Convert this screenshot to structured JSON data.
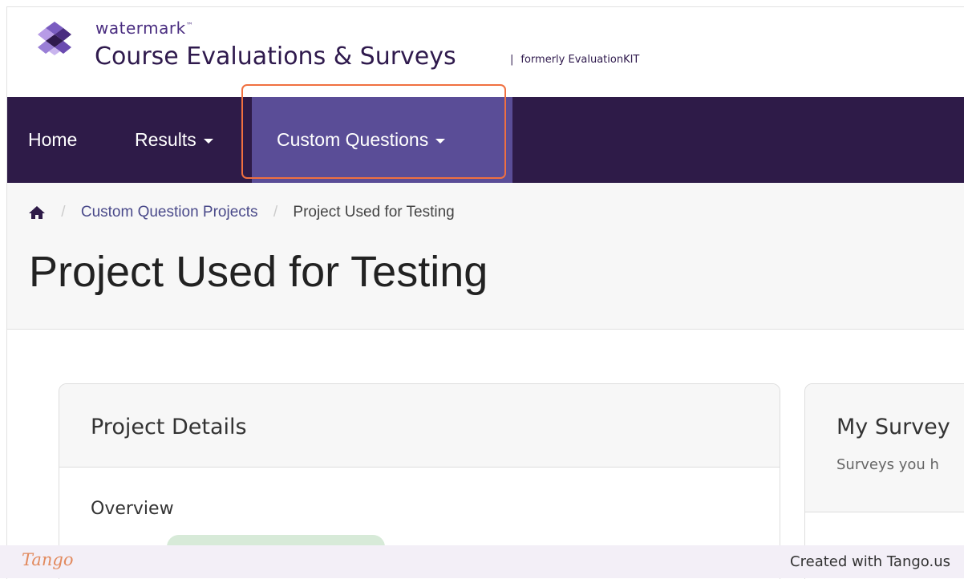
{
  "header": {
    "brand_small": "watermark",
    "trademark": "™",
    "brand_title": "Course Evaluations & Surveys",
    "brand_separator": "|",
    "brand_sub": "formerly EvaluationKIT"
  },
  "nav": {
    "home": "Home",
    "results": "Results",
    "custom_questions": "Custom Questions"
  },
  "breadcrumb": {
    "link": "Custom Question Projects",
    "current": "Project Used for Testing",
    "separator": "/"
  },
  "page": {
    "title": "Project Used for Testing"
  },
  "project_details": {
    "title": "Project Details",
    "overview": "Overview"
  },
  "my_surveys": {
    "title": "My Survey",
    "subtitle": "Surveys you h"
  },
  "tango": {
    "logo": "Tango",
    "credit": "Created with Tango.us"
  },
  "colors": {
    "navbar": "#2e1b48",
    "nav_active": "#5a4d97",
    "highlight": "#f07040",
    "brand": "#4a2d80"
  }
}
